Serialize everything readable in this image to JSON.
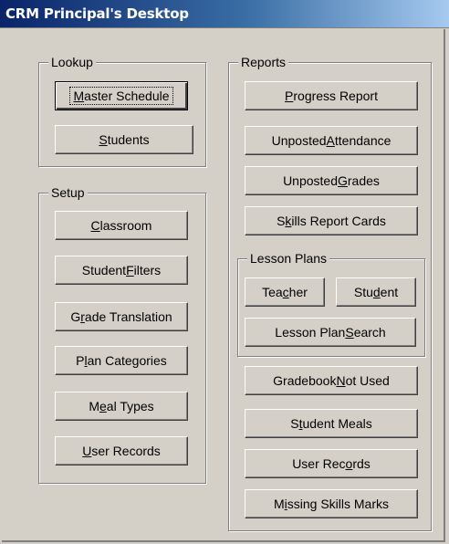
{
  "window": {
    "title": "CRM Principal's Desktop"
  },
  "lookup": {
    "legend": "Lookup",
    "master_schedule": {
      "pre": "",
      "acc": "M",
      "post": "aster Schedule"
    },
    "students": {
      "pre": "",
      "acc": "S",
      "post": "tudents"
    }
  },
  "setup": {
    "legend": "Setup",
    "classroom": {
      "pre": "",
      "acc": "C",
      "post": "lassroom"
    },
    "student_filters": {
      "pre": "Student ",
      "acc": "F",
      "post": "ilters"
    },
    "grade_translation": {
      "pre": "G",
      "acc": "r",
      "post": "ade Translation"
    },
    "plan_categories": {
      "pre": "P",
      "acc": "l",
      "post": "an Categories"
    },
    "meal_types": {
      "pre": "M",
      "acc": "e",
      "post": "al Types"
    },
    "user_records": {
      "pre": "",
      "acc": "U",
      "post": "ser Records"
    }
  },
  "reports": {
    "legend": "Reports",
    "progress_report": {
      "pre": "",
      "acc": "P",
      "post": "rogress Report"
    },
    "unposted_attendance": {
      "pre": "Unposted ",
      "acc": "A",
      "post": "ttendance"
    },
    "unposted_grades": {
      "pre": "Unposted ",
      "acc": "G",
      "post": "rades"
    },
    "skills_report_cards": {
      "pre": "S",
      "acc": "k",
      "post": "ills Report Cards"
    },
    "lesson_plans": {
      "legend": "Lesson Plans",
      "teacher": {
        "pre": "Tea",
        "acc": "c",
        "post": "her"
      },
      "student": {
        "pre": "Stu",
        "acc": "d",
        "post": "ent"
      },
      "lesson_plan_search": {
        "pre": "Lesson Plan ",
        "acc": "S",
        "post": "earch"
      }
    },
    "gradebook_not_used": {
      "pre": "Gradebook ",
      "acc": "N",
      "post": "ot Used"
    },
    "student_meals": {
      "pre": "S",
      "acc": "t",
      "post": "udent Meals"
    },
    "user_records": {
      "pre": "User Rec",
      "acc": "o",
      "post": "rds"
    },
    "missing_skills_marks": {
      "pre": "M",
      "acc": "i",
      "post": "ssing Skills Marks"
    }
  }
}
